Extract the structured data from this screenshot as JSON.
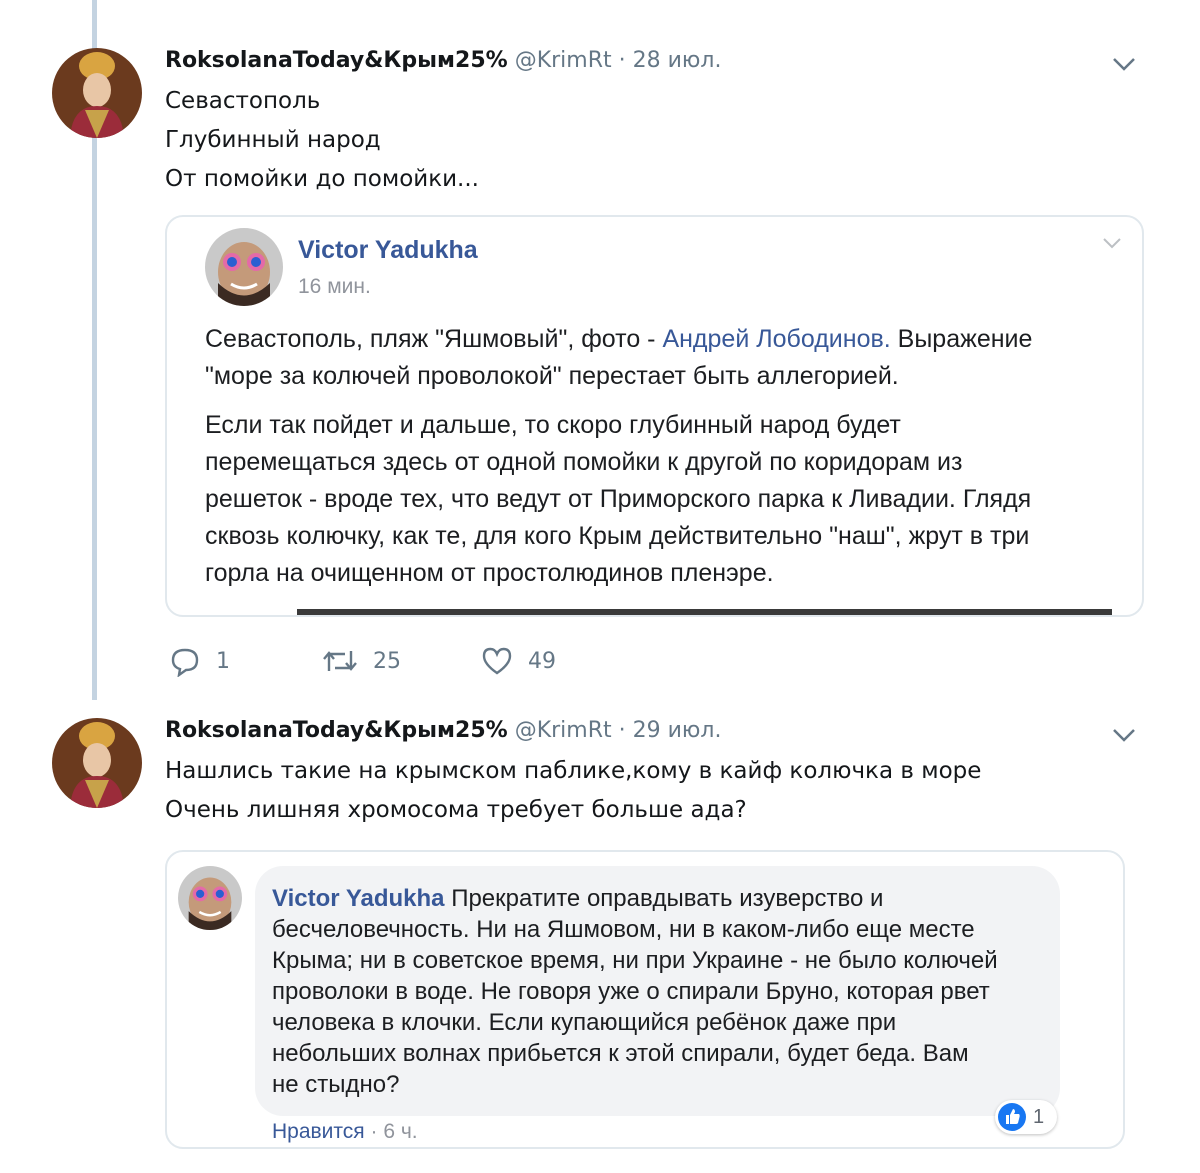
{
  "tweets": [
    {
      "author_name": "RoksolanaToday&Крым25%",
      "meta": "@KrimRt · 28 июл.",
      "lines": [
        "Севастополь",
        "Глубинный народ",
        "От помойки до помойки..."
      ],
      "quote": {
        "author": "Victor Yadukha",
        "time": "16 мин.",
        "p1_line1_a": "Севастополь, пляж \"Яшмовый\", фото - ",
        "p1_line1_link": "Андрей Лободинов.",
        "p1_line1_b": " Выражение",
        "p1_line2": "\"море за колючей проволокой\" перестает быть аллегорией.",
        "p2_lines": [
          "Если так пойдет и дальше, то скоро глубинный народ будет",
          "перемещаться здесь от одной помойки к другой по коридорам из",
          "решеток - вроде тех, что ведут от Приморского парка к Ливадии. Глядя",
          "сквозь колючку, как те, для кого Крым действительно \"наш\", жрут в три",
          "горла на очищенном от простолюдинов пленэре."
        ]
      },
      "actions": {
        "replies": "1",
        "retweets": "25",
        "likes": "49"
      }
    },
    {
      "author_name": "RoksolanaToday&Крым25%",
      "meta": "@KrimRt · 29 июл.",
      "lines": [
        "Нашлись такие на крымском паблике,кому в кайф колючка в море",
        "Очень лишняя хромосома требует больше ада?"
      ],
      "comment": {
        "author": "Victor Yadukha",
        "line1_rest": " Прекратите оправдывать изуверство и",
        "lines": [
          "бесчеловечность. Ни на Яшмовом, ни в каком-либо еще месте",
          "Крыма; ни в советское время, ни при Украине - не было колючей",
          "проволоки в воде. Не говоря уже о спирали Бруно, которая рвет",
          "человека в клочки. Если купающийся ребёнок даже при",
          "небольших волнах прибьется к этой спирали, будет беда. Вам",
          "не стыдно?"
        ],
        "like_count": "1",
        "like_label": "Нравится",
        "time": " · 6 ч."
      }
    }
  ],
  "colors": {
    "link": "#385898",
    "meta": "#657786",
    "thread_line": "#c4d3e1"
  }
}
